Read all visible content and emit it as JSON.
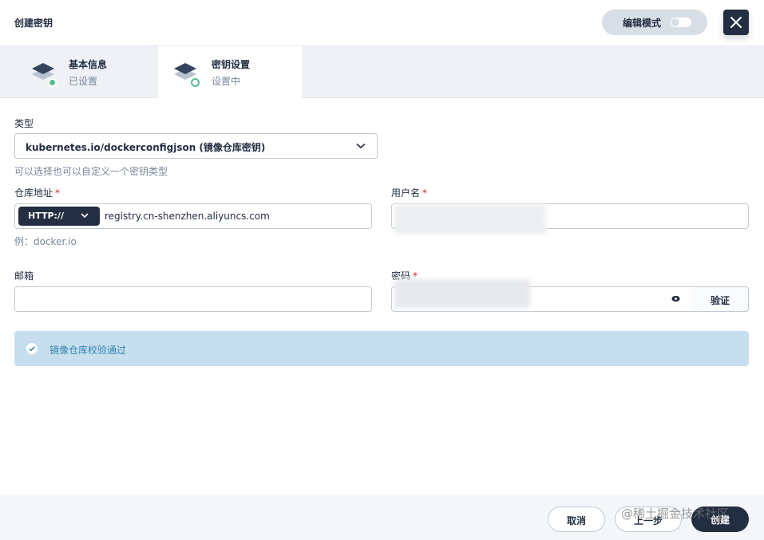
{
  "header": {
    "title": "创建密钥",
    "edit_mode_label": "编辑模式"
  },
  "steps": [
    {
      "title": "基本信息",
      "status": "已设置",
      "status_color": "#55bc8a"
    },
    {
      "title": "密钥设置",
      "status": "设置中",
      "status_color": "#55bc8a"
    }
  ],
  "form": {
    "type": {
      "label": "类型",
      "value": "kubernetes.io/dockerconfigjson (镜像仓库密钥)",
      "hint": "可以选择也可以自定义一个密钥类型"
    },
    "registry": {
      "label": "仓库地址",
      "required_mark": "*",
      "protocol": "HTTP://",
      "value": "registry.cn-shenzhen.aliyuncs.com",
      "hint": "例：docker.io"
    },
    "username": {
      "label": "用户名",
      "required_mark": "*",
      "value": "",
      "obscured": true
    },
    "email": {
      "label": "邮箱",
      "value": ""
    },
    "password": {
      "label": "密码",
      "required_mark": "*",
      "value": "",
      "obscured": true,
      "verify_label": "验证"
    }
  },
  "alert": {
    "text": "镜像仓库校验通过",
    "color": "#3385b0"
  },
  "footer": {
    "cancel_label": "取消",
    "prev_label": "上一步",
    "create_label": "创建"
  },
  "watermark": "@稀土掘金技术社区",
  "colors": {
    "dark": "#242e42",
    "border": "#c1c9d1",
    "muted": "#79879c",
    "success_bg": "#c7deef",
    "required": "#ca2621"
  }
}
